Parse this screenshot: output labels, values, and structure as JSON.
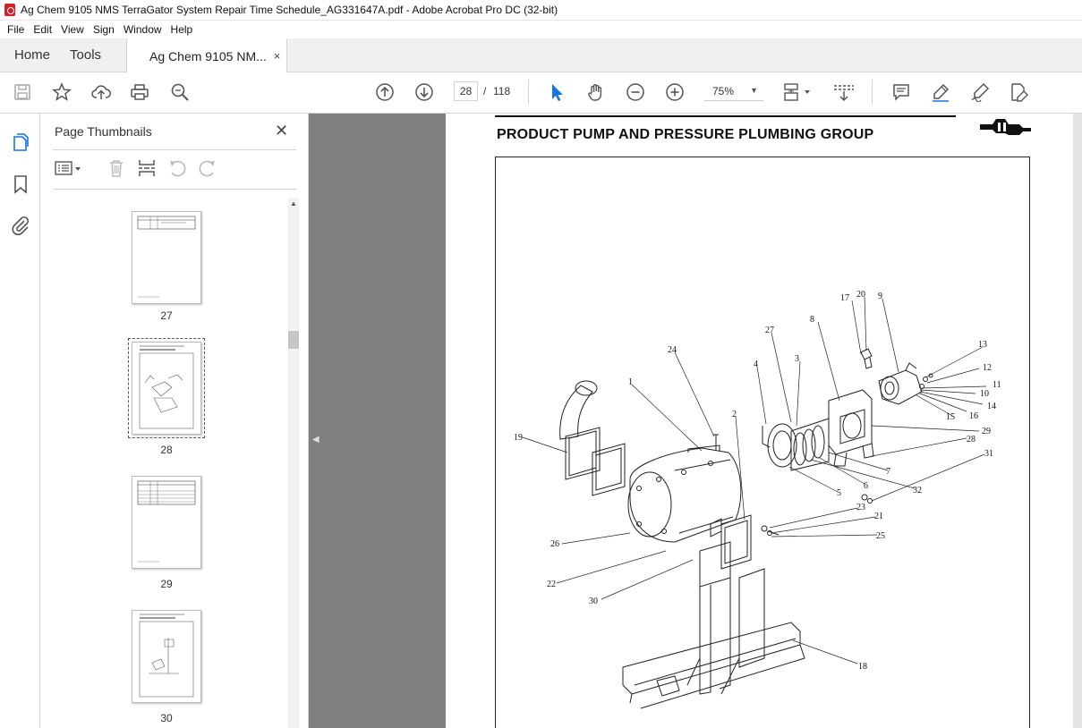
{
  "window": {
    "title": "Ag Chem 9105 NMS TerraGator System Repair Time Schedule_AG331647A.pdf - Adobe Acrobat Pro DC (32-bit)"
  },
  "menubar": [
    "File",
    "Edit",
    "View",
    "Sign",
    "Window",
    "Help"
  ],
  "tabs": {
    "home": "Home",
    "tools": "Tools",
    "document": "Ag Chem 9105 NM...",
    "close_glyph": "×"
  },
  "toolbar": {
    "current_page": "28",
    "page_separator": "/",
    "total_pages": "118",
    "zoom": "75%",
    "icons": [
      "save-icon",
      "star-icon",
      "upload-icon",
      "print-icon",
      "find-icon",
      "page-up-icon",
      "page-down-icon",
      "select-cursor-icon",
      "hand-icon",
      "zoom-out-icon",
      "zoom-in-icon",
      "page-layout-icon",
      "scroll-mode-icon",
      "comment-icon",
      "highlight-icon",
      "sign-icon",
      "edit-pdf-icon"
    ]
  },
  "rail": {
    "icons": [
      "page-thumbnails-icon",
      "bookmark-icon",
      "attachment-icon"
    ]
  },
  "thumbnails_panel": {
    "title": "Page Thumbnails",
    "close_glyph": "✕",
    "tools": [
      "options-icon",
      "delete-icon",
      "extract-icon",
      "undo-icon",
      "redo-icon"
    ],
    "pages": [
      {
        "label": "27",
        "selected": false
      },
      {
        "label": "28",
        "selected": true
      },
      {
        "label": "29",
        "selected": false
      },
      {
        "label": "30",
        "selected": false
      }
    ]
  },
  "document": {
    "heading": "PRODUCT PUMP AND PRESSURE PLUMBING GROUP",
    "callouts": [
      "17",
      "20",
      "9",
      "27",
      "8",
      "13",
      "24",
      "4",
      "3",
      "12",
      "1",
      "11",
      "10",
      "14",
      "16",
      "15",
      "2",
      "29",
      "28",
      "19",
      "31",
      "7",
      "6",
      "32",
      "5",
      "23",
      "21",
      "25",
      "26",
      "22",
      "30",
      "18"
    ]
  },
  "colors": {
    "accent": "#1473e6",
    "doc_background": "#808080",
    "adobe_red": "#d81f26"
  }
}
